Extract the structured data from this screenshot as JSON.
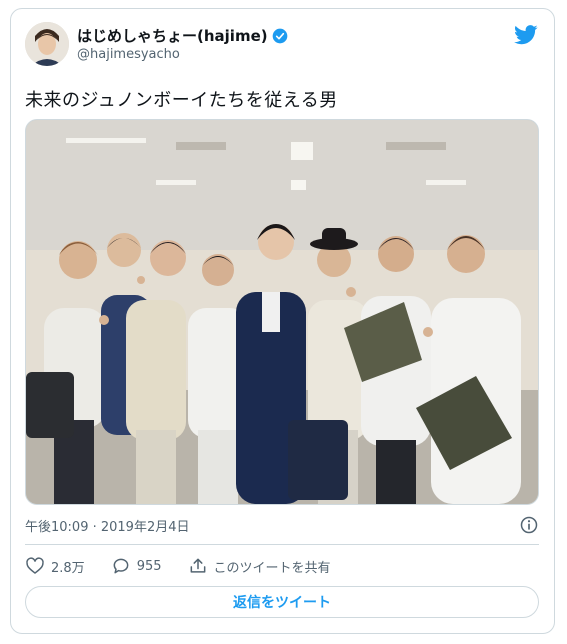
{
  "user": {
    "display_name": "はじめしゃちょー(hajime)",
    "handle": "@hajimesyacho"
  },
  "tweet": {
    "text": "未来のジュノンボーイたちを従える男",
    "timestamp": "午後10:09 · 2019年2月4日"
  },
  "actions": {
    "likes": "2.8万",
    "replies": "955",
    "share_label": "このツイートを共有"
  },
  "reply_button_label": "返信をツイート",
  "colors": {
    "accent": "#1d9bf0",
    "text_secondary": "#536471",
    "border": "#cfd9de"
  },
  "icons": [
    "twitter-bird-icon",
    "verified-badge-icon",
    "info-icon",
    "heart-icon",
    "reply-bubble-icon",
    "share-icon"
  ]
}
